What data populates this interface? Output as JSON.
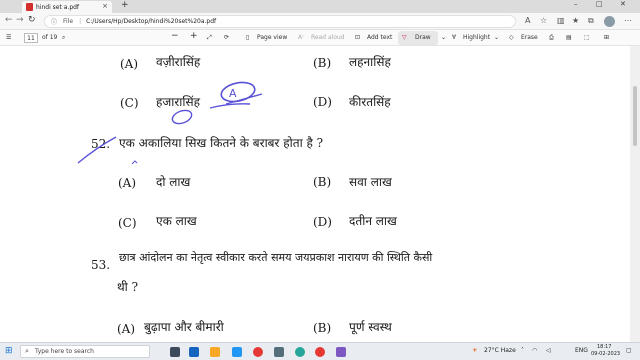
{
  "browser": {
    "tab_title": "hindi set a.pdf",
    "tab_close": "×",
    "new_tab": "+",
    "window_controls": [
      "–",
      "□",
      "✕"
    ],
    "nav": {
      "back": "←",
      "forward": "→",
      "reload": "↻"
    },
    "address_label": "File",
    "address_path": "C:/Users/Hp/Desktop/hindi%20set%20a.pdf"
  },
  "pdf_toolbar": {
    "page_number": "11",
    "page_total": "of 19",
    "zoom_out": "−",
    "zoom_in": "+",
    "page_view": "Page view",
    "read_aloud": "Read aloud",
    "add_text": "Add text",
    "draw": "Draw",
    "highlight": "Highlight",
    "erase": "Erase"
  },
  "document": {
    "q51_options": [
      {
        "letter": "(A)",
        "text": "वज़ीरासिंह"
      },
      {
        "letter": "(B)",
        "text": "लहनासिंह"
      },
      {
        "letter": "(C)",
        "text": "हजारासिंह"
      },
      {
        "letter": "(D)",
        "text": "कीरतसिंह"
      }
    ],
    "q52": {
      "number": "52.",
      "text": "एक अकालिया सिख कितने के बराबर होता है ?",
      "options": [
        {
          "letter": "(A)",
          "text": "दो लाख"
        },
        {
          "letter": "(B)",
          "text": "सवा लाख"
        },
        {
          "letter": "(C)",
          "text": "एक लाख"
        },
        {
          "letter": "(D)",
          "text": "दतीन लाख"
        }
      ]
    },
    "q53": {
      "number": "53.",
      "text_line1": "छात्र आंदोलन का नेतृत्व स्वीकार करते समय जयप्रकाश नारायण की स्थिति कैसी",
      "text_line2": "थी ?",
      "options": [
        {
          "letter": "(A)",
          "text": "बुढ़ापा और बीमारी"
        },
        {
          "letter": "(B)",
          "text": "पूर्ण स्वस्थ"
        }
      ]
    },
    "ink_color": "#5a52d6",
    "annotation_mark": "A"
  },
  "taskbar": {
    "search_placeholder": "Type here to search",
    "weather": "27°C  Haze",
    "language": "ENG",
    "time": "18:17",
    "date": "09-02-2023"
  }
}
